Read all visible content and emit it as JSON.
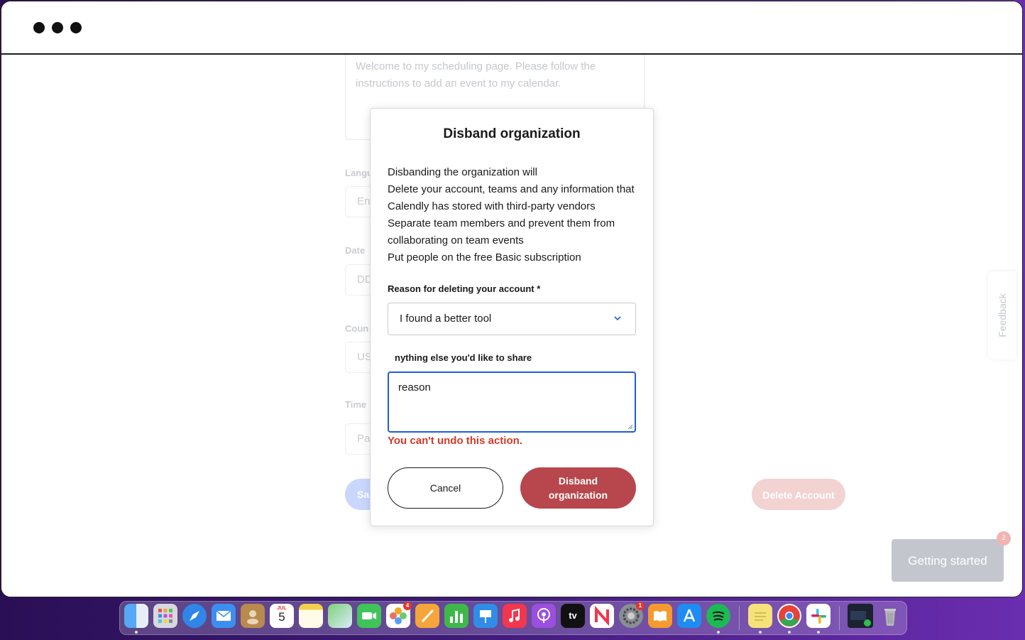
{
  "window": {
    "controls": [
      "close",
      "minimize",
      "zoom"
    ]
  },
  "background_page": {
    "welcome_text": "Welcome to my scheduling page. Please follow the instructions to add an event to my calendar.",
    "labels": {
      "language": "Langu",
      "date": "Date",
      "country": "Coun",
      "time": "Time"
    },
    "fields": {
      "language": "En",
      "date": "DD",
      "country": "US",
      "time": "Pa"
    },
    "save_label": "Sa",
    "delete_account_label": "Delete Account",
    "feedback_label": "Feedback",
    "getting_started_label": "Getting started",
    "getting_started_badge": "2"
  },
  "modal": {
    "title": "Disband organization",
    "body": [
      "Disbanding the organization will",
      "Delete your account, teams and any information that Calendly has stored with third-party vendors",
      "Separate team members and prevent them from collaborating on team events",
      "Put people on the free Basic subscription"
    ],
    "reason_label": "Reason for deleting your account *",
    "reason_value": "I found a better tool",
    "share_label": "nything else you'd like to share",
    "share_value": "reason",
    "warning": "You can't undo this action.",
    "cancel_label": "Cancel",
    "disband_label": "Disband organization"
  },
  "dock": {
    "calendar_month": "JUL",
    "calendar_day": "5",
    "photos_badge": "4",
    "settings_badge": "1",
    "tv_label": "tv",
    "items": [
      "finder",
      "launchpad",
      "safari",
      "mail",
      "contacts",
      "calendar",
      "notes",
      "maps",
      "facetime",
      "photos",
      "pages",
      "numbers",
      "keynote",
      "music",
      "podcasts",
      "apple-tv",
      "news",
      "system-settings",
      "books",
      "app-store",
      "spotify",
      "stickies",
      "chrome",
      "slack",
      "screen-recording",
      "trash"
    ]
  },
  "colors": {
    "accent_blue": "#1f5bdc",
    "danger_red": "#b7474c",
    "warning_text": "#d13a2a"
  }
}
